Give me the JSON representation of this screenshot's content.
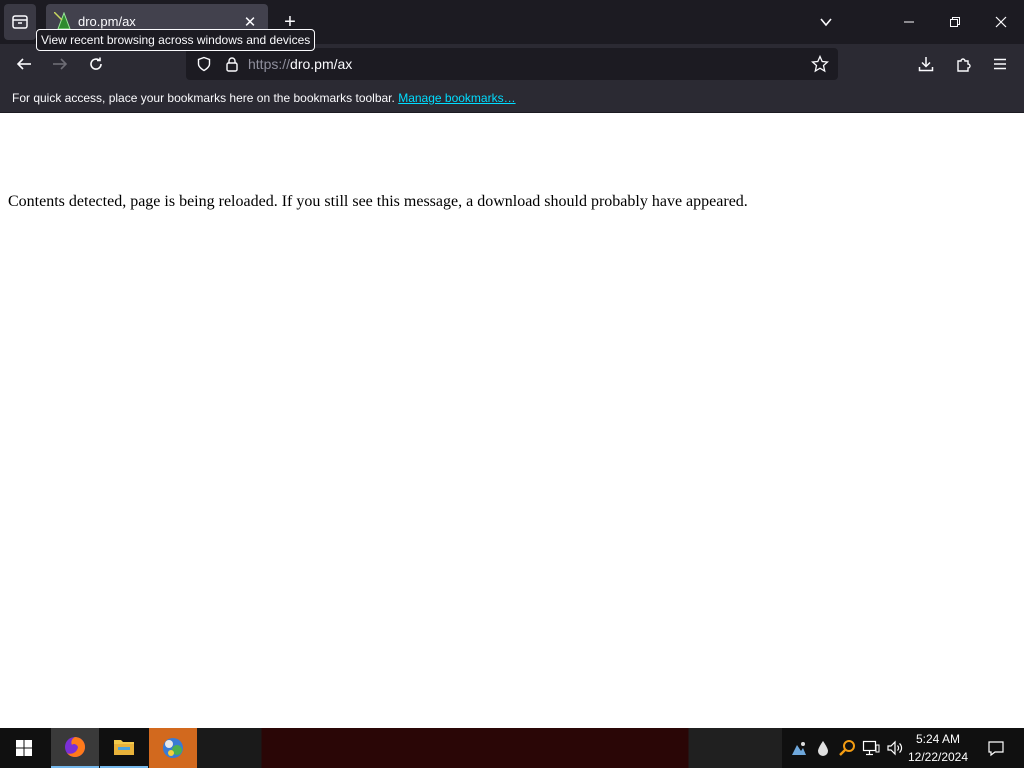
{
  "browser": {
    "tab": {
      "title": "dro.pm/ax",
      "close_glyph": "✕"
    },
    "new_tab_glyph": "+",
    "tooltip": "View recent browsing across windows and devices",
    "url": {
      "scheme": "https://",
      "host_path": "dro.pm/ax"
    },
    "bookmarks_bar": {
      "message": "For quick access, place your bookmarks here on the bookmarks toolbar.",
      "link": "Manage bookmarks…"
    },
    "colors": {
      "chrome_dark": "#1c1b22",
      "toolbar": "#2b2a33",
      "tab_active": "#42414d",
      "link": "#00ddff"
    }
  },
  "page": {
    "message": "Contents detected, page is being reloaded. If you still see this message, a download should probably have appeared."
  },
  "taskbar": {
    "apps": [
      "firefox-icon",
      "file-explorer-icon",
      "app-icon"
    ],
    "clock": {
      "time": "5:24 AM",
      "date": "12/22/2024"
    }
  }
}
